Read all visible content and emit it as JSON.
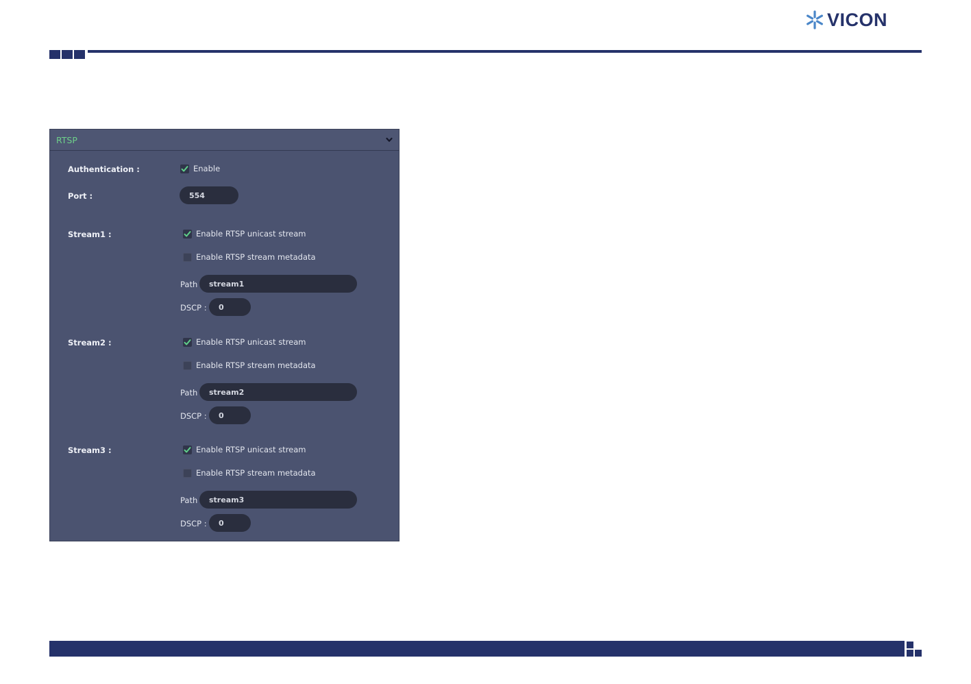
{
  "brand": {
    "logo_text": "VICON"
  },
  "panel": {
    "title": "RTSP",
    "authentication": {
      "label": "Authentication :",
      "checkbox_label": "Enable",
      "checked": true
    },
    "port": {
      "label": "Port :",
      "value": "554"
    },
    "streams": [
      {
        "label": "Stream1 :",
        "unicast": {
          "label": "Enable RTSP unicast stream",
          "checked": true
        },
        "metadata": {
          "label": "Enable RTSP stream metadata",
          "checked": false
        },
        "path_label": "Path",
        "path_value": "stream1",
        "dscp_label": "DSCP :",
        "dscp_value": "0"
      },
      {
        "label": "Stream2 :",
        "unicast": {
          "label": "Enable RTSP unicast stream",
          "checked": true
        },
        "metadata": {
          "label": "Enable RTSP stream metadata",
          "checked": false
        },
        "path_label": "Path",
        "path_value": "stream2",
        "dscp_label": "DSCP :",
        "dscp_value": "0"
      },
      {
        "label": "Stream3 :",
        "unicast": {
          "label": "Enable RTSP unicast stream",
          "checked": true
        },
        "metadata": {
          "label": "Enable RTSP stream metadata",
          "checked": false
        },
        "path_label": "Path",
        "path_value": "stream3",
        "dscp_label": "DSCP :",
        "dscp_value": "0"
      }
    ]
  },
  "colors": {
    "brand_navy": "#25326a",
    "logo_blue": "#4a86c8",
    "panel_bg": "#4b5370",
    "title_green": "#6ed08a",
    "check_green": "#5fd08a"
  },
  "icons": {
    "logo": "vicon-star-icon",
    "collapse": "chevron-down-icon",
    "check": "check-icon"
  }
}
